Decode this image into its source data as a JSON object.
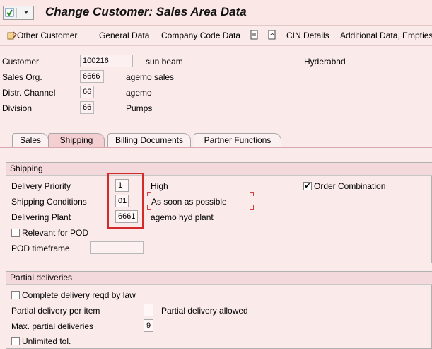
{
  "window": {
    "title": "Change Customer: Sales Area Data"
  },
  "toolbar": {
    "other_customer": "Other Customer",
    "general_data": "General Data",
    "company_code_data": "Company Code Data",
    "cin_details": "CIN Details",
    "additional_data": "Additional Data, Empties"
  },
  "header": {
    "customer_label": "Customer",
    "customer_value": "100216",
    "customer_name": "sun beam",
    "customer_city": "Hyderabad",
    "sales_org_label": "Sales Org.",
    "sales_org_value": "6666",
    "sales_org_desc": "agemo sales",
    "distr_channel_label": "Distr. Channel",
    "distr_channel_value": "66",
    "distr_channel_desc": "agemo",
    "division_label": "Division",
    "division_value": "66",
    "division_desc": "Pumps"
  },
  "tabs": [
    {
      "label": "Sales",
      "active": false
    },
    {
      "label": "Shipping",
      "active": true
    },
    {
      "label": "Billing Documents",
      "active": false
    },
    {
      "label": "Partner Functions",
      "active": false
    }
  ],
  "shipping": {
    "group_title": "Shipping",
    "delivery_priority_label": "Delivery Priority",
    "delivery_priority_value": "1",
    "delivery_priority_desc": "High",
    "order_combination_label": "Order Combination",
    "order_combination_checked": true,
    "shipping_conditions_label": "Shipping Conditions",
    "shipping_conditions_value": "01",
    "shipping_conditions_desc": "As soon as possible",
    "delivering_plant_label": "Delivering Plant",
    "delivering_plant_value": "6661",
    "delivering_plant_desc": "agemo hyd plant",
    "relevant_pod_label": "Relevant for POD",
    "relevant_pod_checked": false,
    "pod_timeframe_label": "POD timeframe",
    "pod_timeframe_value": ""
  },
  "partial": {
    "group_title": "Partial deliveries",
    "complete_delivery_label": "Complete delivery reqd by law",
    "complete_delivery_checked": false,
    "per_item_label": "Partial delivery per item",
    "per_item_value": "",
    "per_item_desc": "Partial delivery allowed",
    "max_partial_label": "Max. partial deliveries",
    "max_partial_value": "9",
    "unlimited_tol_label": "Unlimited tol.",
    "unlimited_tol_checked": false
  },
  "colors": {
    "highlight": "#d32b2b",
    "background": "#fbeaea",
    "active_tab": "#f4cfd2"
  }
}
